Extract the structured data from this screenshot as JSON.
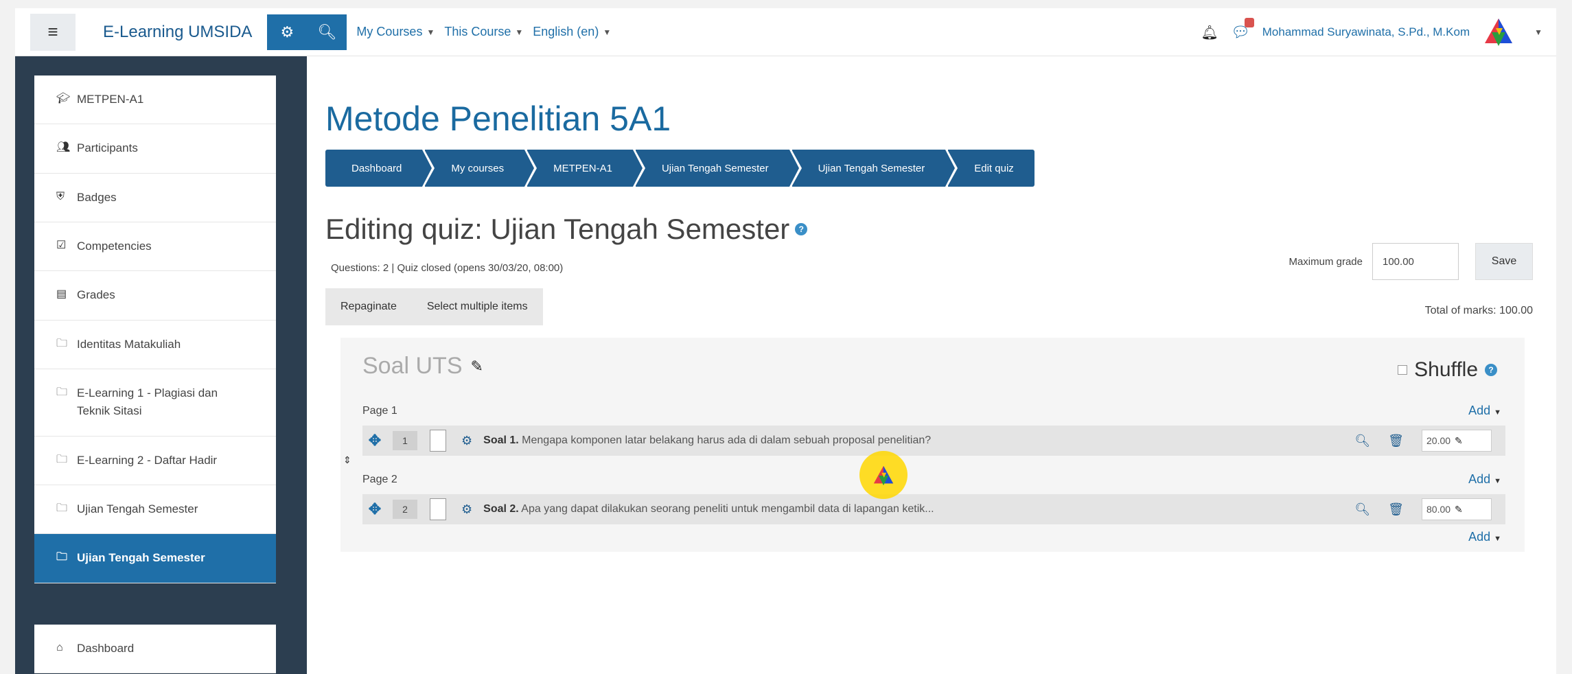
{
  "navbar": {
    "site_name": "E-Learning UMSIDA",
    "menus": [
      "My Courses",
      "This Course",
      "English (en)"
    ],
    "username": "Mohammad Suryawinata, S.Pd., M.Kom"
  },
  "sidebar": {
    "items": [
      {
        "icon": "graduation-cap-icon",
        "label": "METPEN-A1"
      },
      {
        "icon": "users-icon",
        "label": "Participants"
      },
      {
        "icon": "shield-icon",
        "label": "Badges"
      },
      {
        "icon": "check-square-icon",
        "label": "Competencies"
      },
      {
        "icon": "table-icon",
        "label": "Grades"
      },
      {
        "icon": "folder-icon",
        "label": "Identitas Matakuliah"
      },
      {
        "icon": "folder-icon",
        "label": "E-Learning 1 - Plagiasi dan Teknik Sitasi"
      },
      {
        "icon": "folder-icon",
        "label": "E-Learning 2 - Daftar Hadir"
      },
      {
        "icon": "folder-icon",
        "label": "Ujian Tengah Semester"
      },
      {
        "icon": "folder-icon",
        "label": "Ujian Tengah Semester"
      }
    ],
    "dashboard": "Dashboard"
  },
  "main": {
    "page_title": "Metode Penelitian 5A1",
    "breadcrumb": [
      "Dashboard",
      "My courses",
      "METPEN-A1",
      "Ujian Tengah Semester",
      "Ujian Tengah Semester",
      "Edit quiz"
    ],
    "quiz_heading": "Editing quiz: Ujian Tengah Semester",
    "quiz_info": "Questions: 2 | Quiz closed (opens 30/03/20, 08:00)",
    "repaginate": "Repaginate",
    "select_multiple": "Select multiple items",
    "max_grade_label": "Maximum grade",
    "max_grade_value": "100.00",
    "save": "Save",
    "total_marks": "Total of marks: 100.00"
  },
  "section": {
    "title": "Soal UTS",
    "shuffle": "Shuffle",
    "add": "Add",
    "pages": [
      {
        "label": "Page 1",
        "question": {
          "num": "1",
          "name": "Soal 1.",
          "text": "Mengapa komponen latar belakang harus ada di dalam sebuah proposal penelitian?",
          "mark": "20.00"
        }
      },
      {
        "label": "Page 2",
        "question": {
          "num": "2",
          "name": "Soal 2.",
          "text": "Apa yang dapat dilakukan seorang peneliti untuk mengambil data di lapangan ketik...",
          "mark": "80.00"
        }
      }
    ]
  },
  "colors": {
    "accent": "#1f6fa8",
    "sidebar_bg": "#2c3e50",
    "breadcrumb_bg": "#1f5d8f",
    "cursor_highlight": "#ffd700"
  }
}
